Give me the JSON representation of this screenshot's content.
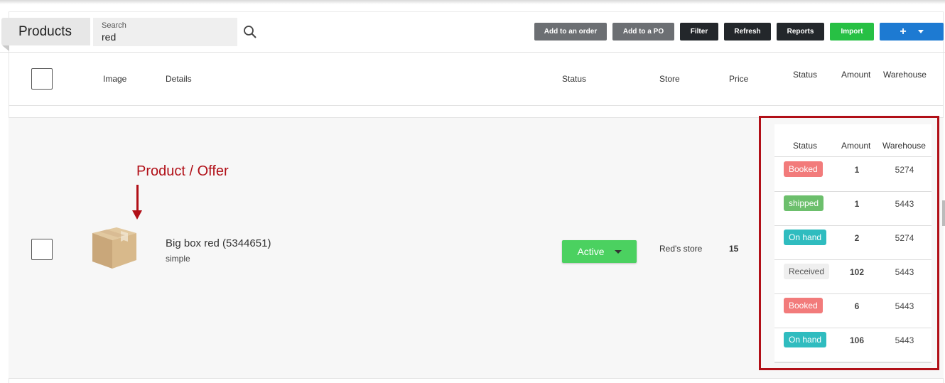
{
  "header": {
    "title": "Products",
    "search": {
      "label": "Search",
      "value": "red"
    }
  },
  "toolbar": {
    "add_to_order": "Add to an order",
    "add_to_po": "Add to a PO",
    "filter": "Filter",
    "refresh": "Refresh",
    "reports": "Reports",
    "import": "Import",
    "add": "+"
  },
  "columns": {
    "image": "Image",
    "details": "Details",
    "status": "Status",
    "store": "Store",
    "price": "Price",
    "inv_status": "Status",
    "inv_amount": "Amount",
    "inv_warehouse": "Warehouse"
  },
  "annotation": "Product / Offer",
  "product": {
    "name": "Big box red (5344651)",
    "type": "simple",
    "status": "Active",
    "store": "Red's store",
    "price": "15",
    "image_icon": "cardboard-box-icon"
  },
  "inventory": [
    {
      "status": "Booked",
      "amount": "1",
      "warehouse": "5274",
      "color": "#f27b7b"
    },
    {
      "status": "shipped",
      "amount": "1",
      "warehouse": "5443",
      "color": "#6cbf6c"
    },
    {
      "status": "On hand",
      "amount": "2",
      "warehouse": "5274",
      "color": "#2fbcbf"
    },
    {
      "status": "Received",
      "amount": "102",
      "warehouse": "5443",
      "color": "#efefef"
    },
    {
      "status": "Booked",
      "amount": "6",
      "warehouse": "5443",
      "color": "#f27b7b"
    },
    {
      "status": "On hand",
      "amount": "106",
      "warehouse": "5443",
      "color": "#2fbcbf"
    }
  ],
  "colors": {
    "highlight": "#b10f17",
    "active_green": "#4bd160",
    "primary_blue": "#1d7ad2",
    "import_green": "#27c044"
  }
}
